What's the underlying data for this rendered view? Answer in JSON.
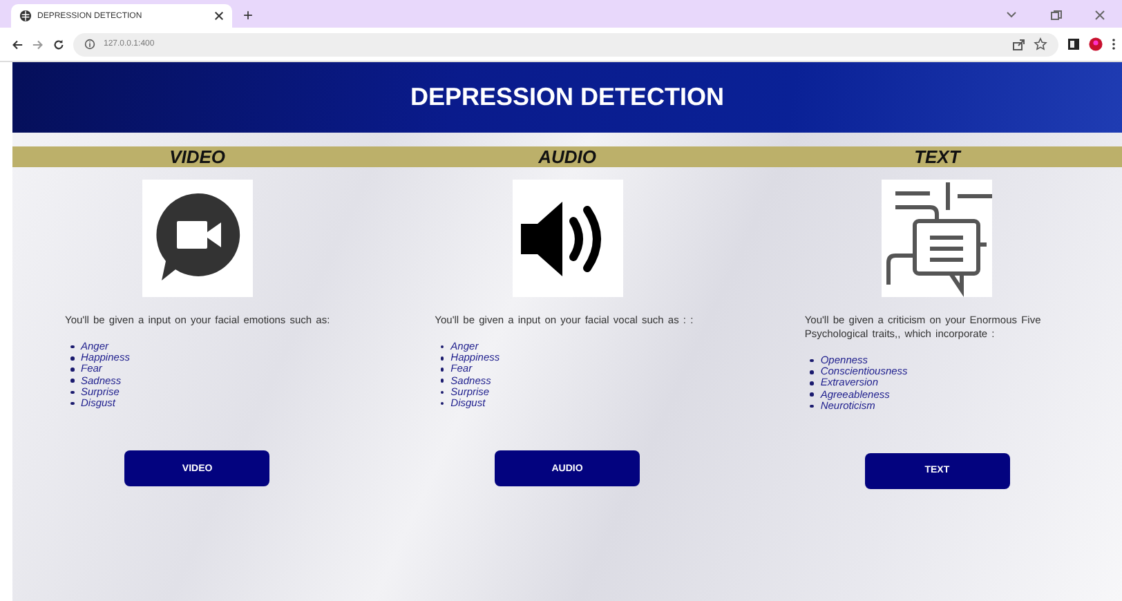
{
  "browser": {
    "tab_title": "DEPRESSION DETECTION",
    "new_tab": "+",
    "url": "127.0.0.1:400"
  },
  "header": {
    "title": "DEPRESSION DETECTION"
  },
  "sections": [
    {
      "kind": "video",
      "heading": "VIDEO",
      "description": "You'll be given a input on your facial emotions such as:",
      "items": [
        "Anger",
        "Happiness",
        "Fear",
        "Sadness",
        "Surprise",
        "Disgust"
      ],
      "button": "VIDEO"
    },
    {
      "kind": "audio",
      "heading": "AUDIO",
      "description": "You'll be given a input on your facial vocal such as : :",
      "items": [
        "Anger",
        "Happiness",
        "Fear",
        "Sadness",
        "Surprise",
        "Disgust"
      ],
      "button": "AUDIO"
    },
    {
      "kind": "text",
      "heading": "TEXT",
      "description": "You'll be given a criticism on your Enormous Five Psychological traits,, which incorporate :",
      "items": [
        "Openness",
        "Conscientiousness",
        "Extraversion",
        "Agreeableness",
        "Neuroticism"
      ],
      "button": "TEXT"
    }
  ]
}
